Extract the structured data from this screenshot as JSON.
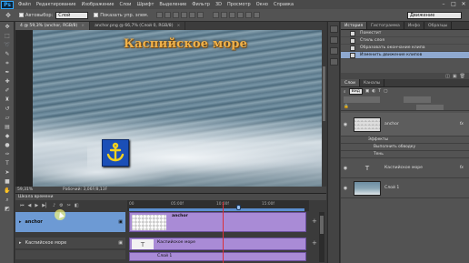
{
  "app": {
    "logo": "Ps",
    "menu": [
      "Файл",
      "Редактирование",
      "Изображение",
      "Слои",
      "Шрифт",
      "Выделение",
      "Фильтр",
      "3D",
      "Просмотр",
      "Окно",
      "Справка"
    ],
    "window_controls": [
      "–",
      "□",
      "✕"
    ]
  },
  "options": {
    "autoselect_label": "Автовыбор:",
    "autoselect_target": "Слой",
    "show_controls_label": "Показать упр. элем.",
    "workspace": "Движение"
  },
  "tools": [
    "move-icon",
    "marquee-icon",
    "lasso-icon",
    "quick-select-icon",
    "crop-icon",
    "eyedropper-icon",
    "healing-icon",
    "brush-icon",
    "stamp-icon",
    "history-brush-icon",
    "eraser-icon",
    "gradient-icon",
    "blur-icon",
    "dodge-icon",
    "pen-icon",
    "type-icon",
    "path-select-icon",
    "shape-icon",
    "hand-icon",
    "zoom-icon"
  ],
  "documents": {
    "tabs": [
      {
        "label": "4 @ 59,3% (anchor, RGB/8)",
        "active": true
      },
      {
        "label": "anchor.png @ 66,7% (Слой 0, RGB/8)",
        "active": false
      }
    ]
  },
  "canvas": {
    "title_text": "Каспийское море"
  },
  "status": {
    "zoom": "59,31%",
    "doc_info": "Рабочий: 3,06F/8,13F"
  },
  "timeline": {
    "title": "Шкала времени",
    "ticks": [
      "00",
      "05:00f",
      "10:00f",
      "15:00f"
    ],
    "tracks": [
      {
        "label": "anchor",
        "clip": "anchor"
      },
      {
        "label": "Каспийское море",
        "clip": "Каспийское море"
      },
      {
        "label": "",
        "clip": "Слой 1"
      }
    ],
    "plus": "+"
  },
  "panels": {
    "top_tabs": [
      "История",
      "Гистограмма",
      "Инфо",
      "Образцы"
    ],
    "history_items": [
      {
        "label": "Поместит",
        "active": false
      },
      {
        "label": "Стиль слоя",
        "active": false
      },
      {
        "label": "Образовать окончание клипа",
        "active": false
      },
      {
        "label": "Изменить движение клипов",
        "active": true
      }
    ],
    "layer_tabs": [
      "Слои",
      "Каналы"
    ],
    "filter_label": "Вид",
    "layers": [
      {
        "name": "anchor",
        "fx": "fx",
        "effects_label": "Эффекты",
        "effects": [
          "Выполнить обводку",
          "Тень"
        ]
      },
      {
        "name": "Каспийское море",
        "fx": "fx"
      },
      {
        "name": "Слой 1"
      }
    ]
  },
  "colors": {
    "accent_timeline": "#a98bd6",
    "selected_track": "#6d9ad4",
    "playhead": "#d9313a",
    "title_gold": "#f0b24a",
    "anchor_blue": "#1b4fb7"
  }
}
